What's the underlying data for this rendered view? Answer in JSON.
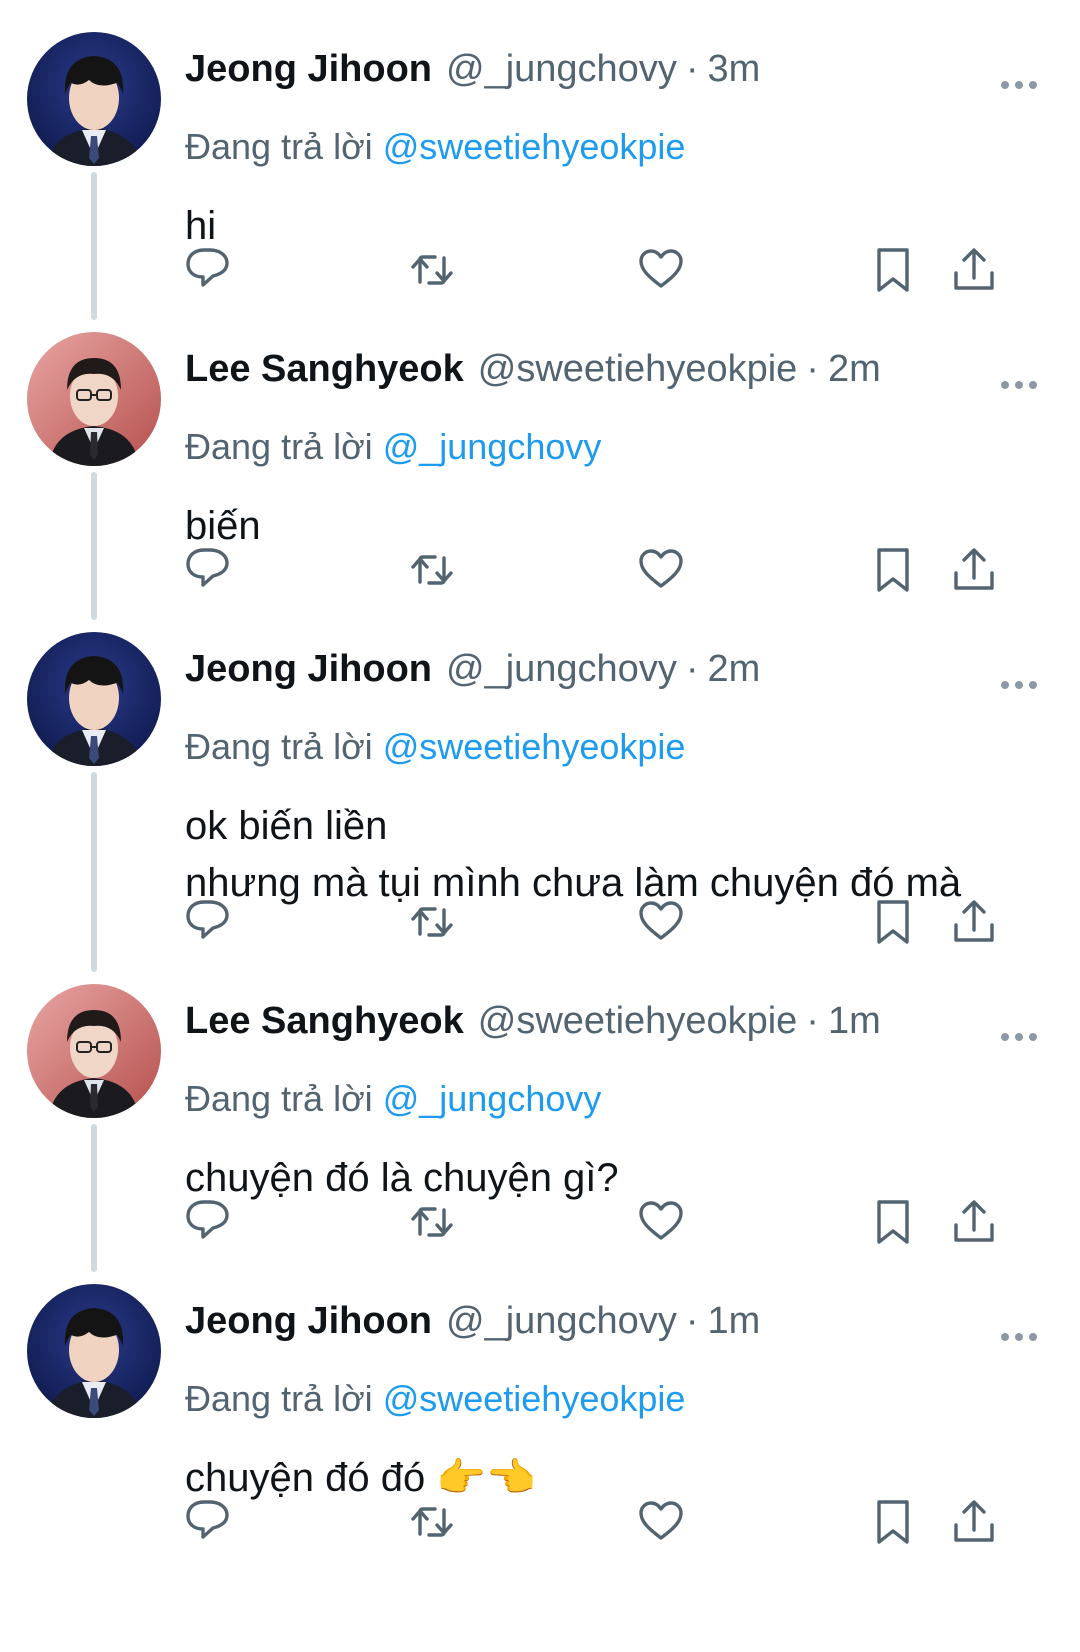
{
  "reply_prefix": "Đang trả lời",
  "colors": {
    "link": "#1d9bf0",
    "secondary": "#536471",
    "thread_line": "#cfd9de"
  },
  "icons": {
    "more": "more-horizontal-icon",
    "reply": "reply-bubble-icon",
    "retweet": "retweet-icon",
    "like": "heart-icon",
    "bookmark": "bookmark-icon",
    "share": "share-upload-icon"
  },
  "tweets": [
    {
      "name": "Jeong Jihoon",
      "handle": "@_jungchovy",
      "time": "3m",
      "replying_to": "@sweetiehyeokpie",
      "text": [
        "hi"
      ]
    },
    {
      "name": "Lee Sanghyeok",
      "handle": "@sweetiehyeokpie",
      "time": "2m",
      "replying_to": "@_jungchovy",
      "text": [
        "biến"
      ]
    },
    {
      "name": "Jeong Jihoon",
      "handle": "@_jungchovy",
      "time": "2m",
      "replying_to": "@sweetiehyeokpie",
      "text": [
        "ok biến liền",
        "nhưng mà tụi mình chưa làm chuyện đó mà"
      ]
    },
    {
      "name": "Lee Sanghyeok",
      "handle": "@sweetiehyeokpie",
      "time": "1m",
      "replying_to": "@_jungchovy",
      "text": [
        "chuyện đó là chuyện gì?"
      ]
    },
    {
      "name": "Jeong Jihoon",
      "handle": "@_jungchovy",
      "time": "1m",
      "replying_to": "@sweetiehyeokpie",
      "text": [
        "chuyện đó đó 👉👈"
      ]
    }
  ]
}
